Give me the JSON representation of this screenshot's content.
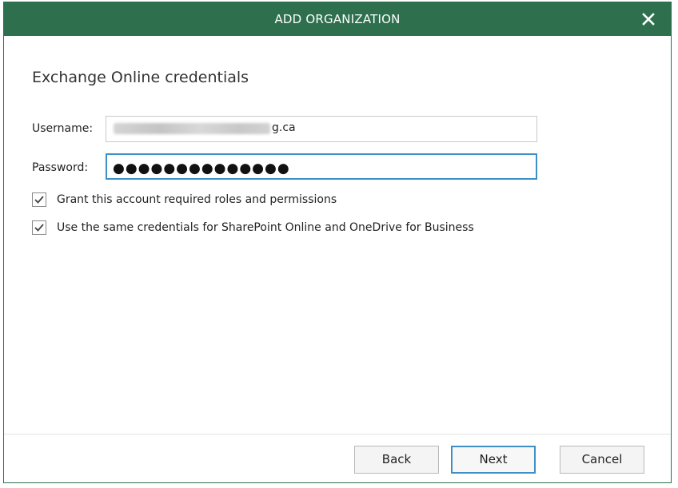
{
  "dialog": {
    "title": "ADD ORGANIZATION",
    "close_glyph": "✕",
    "heading": "Exchange Online credentials"
  },
  "form": {
    "username_label": "Username:",
    "username_visible_suffix": "g.ca",
    "password_label": "Password:",
    "password_mask": "●●●●●●●●●●●●●●"
  },
  "options": [
    {
      "label": "Grant this account required roles and permissions",
      "checked": true
    },
    {
      "label": "Use the same credentials for SharePoint Online and OneDrive for Business",
      "checked": true
    }
  ],
  "buttons": {
    "back": "Back",
    "next": "Next",
    "cancel": "Cancel"
  },
  "colors": {
    "titlebar": "#2e704e",
    "focus_border": "#3d8fc6"
  },
  "icons": {
    "close": "close-icon",
    "check": "checkmark-icon"
  }
}
